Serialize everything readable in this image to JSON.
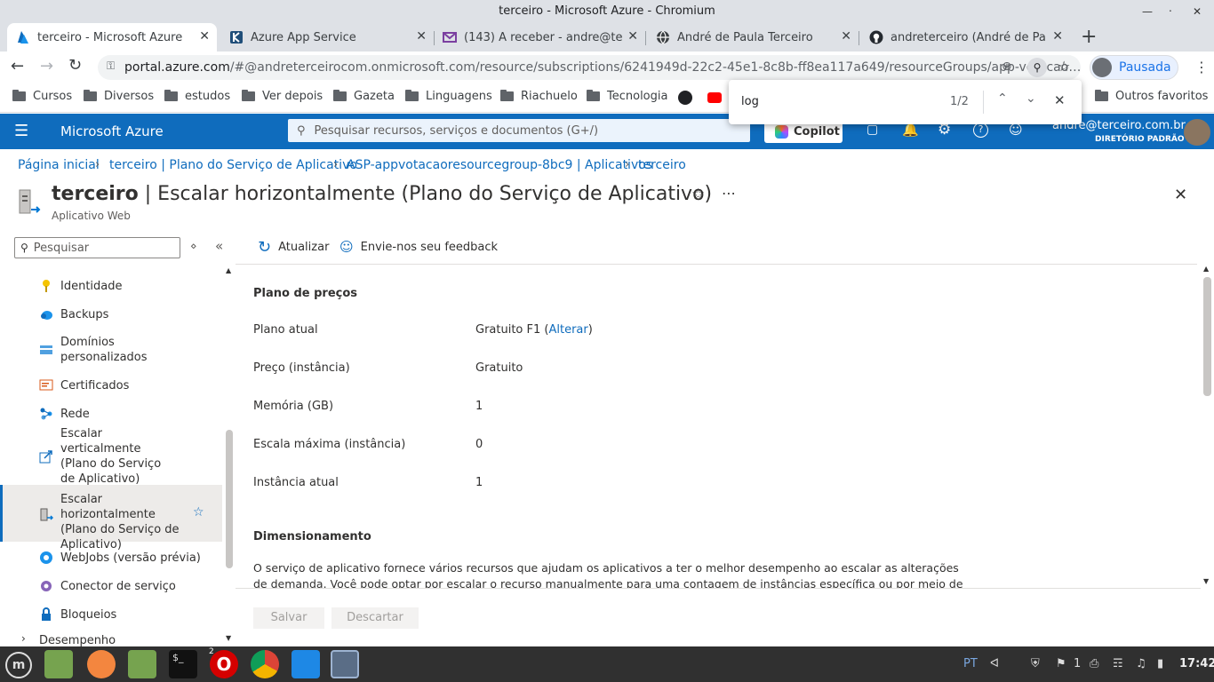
{
  "window": {
    "title": "terceiro - Microsoft Azure - Chromium"
  },
  "tabs": [
    {
      "title": "terceiro - Microsoft Azure",
      "active": true
    },
    {
      "title": "Azure App Service",
      "active": false
    },
    {
      "title": "(143) A receber - andre@terceiro.com.br",
      "active": false
    },
    {
      "title": "André de Paula Terceiro",
      "active": false
    },
    {
      "title": "andreterceiro (André de Paula Terceiro)",
      "active": false
    }
  ],
  "address": {
    "host": "portal.azure.com",
    "path": "/#@andreterceirocom.onmicrosoft.com/resource/subscriptions/6241949d-22c2-45e1-8c8b-ff8ea117a649/resourceGroups/app-votacao…",
    "profile_label": "Pausada"
  },
  "bookmarks": [
    "Cursos",
    "Diversos",
    "estudos",
    "Ver depois",
    "Gazeta",
    "Linguagens",
    "Riachuelo",
    "Tecnologia"
  ],
  "other_bookmarks": "Outros favoritos",
  "find": {
    "query": "log",
    "count": "1/2"
  },
  "azure": {
    "brand": "Microsoft Azure",
    "search_placeholder": "Pesquisar recursos, serviços e documentos (G+/)",
    "copilot": "Copilot",
    "user_email": "andre@terceiro.com.br",
    "user_directory": "DIRETÓRIO PADRÃO"
  },
  "breadcrumb": [
    "Página inicial",
    "terceiro | Plano do Serviço de Aplicativo",
    "ASP-appvotacaoresourcegroup-8bc9 | Aplicativos",
    "terceiro"
  ],
  "page": {
    "title_bold": "terceiro",
    "title_rest": " | Escalar horizontalmente (Plano do Serviço de Aplicativo)",
    "subtitle": "Aplicativo Web"
  },
  "sidebar": {
    "search_placeholder": "Pesquisar",
    "items": [
      {
        "label": "Identidade"
      },
      {
        "label": "Backups"
      },
      {
        "label": "Domínios personalizados"
      },
      {
        "label": "Certificados"
      },
      {
        "label": "Rede"
      },
      {
        "label": "Escalar verticalmente (Plano do Serviço de Aplicativo)"
      },
      {
        "label": "Escalar horizontalmente (Plano do Serviço de Aplicativo)"
      },
      {
        "label": "WebJobs (versão prévia)"
      },
      {
        "label": "Conector de serviço"
      },
      {
        "label": "Bloqueios"
      },
      {
        "label": "Desempenho"
      }
    ]
  },
  "toolbar": {
    "refresh": "Atualizar",
    "feedback": "Envie-nos seu feedback"
  },
  "pricing": {
    "heading": "Plano de preços",
    "rows": [
      {
        "label": "Plano atual",
        "value": "Gratuito F1",
        "link": "Alterar"
      },
      {
        "label": "Preço (instância)",
        "value": "Gratuito"
      },
      {
        "label": "Memória (GB)",
        "value": "1"
      },
      {
        "label": "Escala máxima (instância)",
        "value": "0"
      },
      {
        "label": "Instância atual",
        "value": "1"
      }
    ]
  },
  "scaling": {
    "heading": "Dimensionamento",
    "line1": "O serviço de aplicativo fornece vários recursos que ajudam os aplicativos a ter o melhor desempenho ao escalar as alterações",
    "line2": "de demanda. Você pode optar por escalar o recurso manualmente para uma contagem de instâncias específica ou por meio de"
  },
  "actions": {
    "save": "Salvar",
    "discard": "Descartar"
  },
  "taskbar": {
    "language": "PT",
    "notif_count": "1",
    "clock": "17:42",
    "opera_badge": "2"
  }
}
